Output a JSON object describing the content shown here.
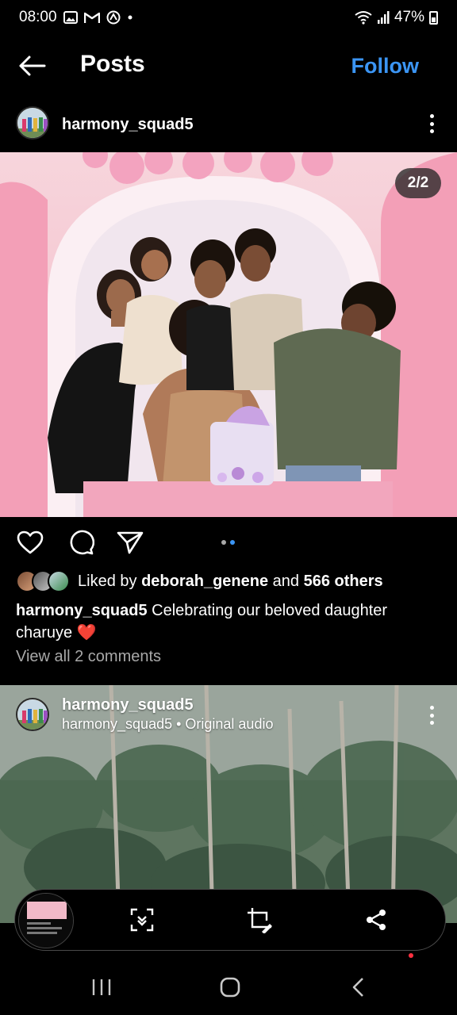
{
  "status_bar": {
    "time": "08:00",
    "battery": "47%"
  },
  "app_bar": {
    "title": "Posts",
    "follow_label": "Follow"
  },
  "post": {
    "username": "harmony_squad5",
    "image_counter": "2/2",
    "likes_prefix": "Liked by ",
    "liked_by_user": "deborah_genene",
    "likes_middle": " and ",
    "likes_others": "566 others",
    "caption_user": "harmony_squad5",
    "caption_text": "Celebrating our beloved daughter charuye",
    "caption_emoji": "❤️",
    "view_comments": "View all 2 comments"
  },
  "next_post": {
    "username": "harmony_squad5",
    "subtitle": "harmony_squad5 • Original audio"
  },
  "colors": {
    "accent": "#3b95f4",
    "heart": "#e0245e",
    "secondary_text": "#a8a8a8",
    "background": "#000000"
  },
  "icons": [
    "back-arrow-icon",
    "more-vert-icon",
    "heart-icon",
    "comment-icon",
    "share-send-icon",
    "scan-icon",
    "crop-edit-icon",
    "share-icon",
    "recents-icon",
    "home-icon",
    "back-nav-icon"
  ]
}
